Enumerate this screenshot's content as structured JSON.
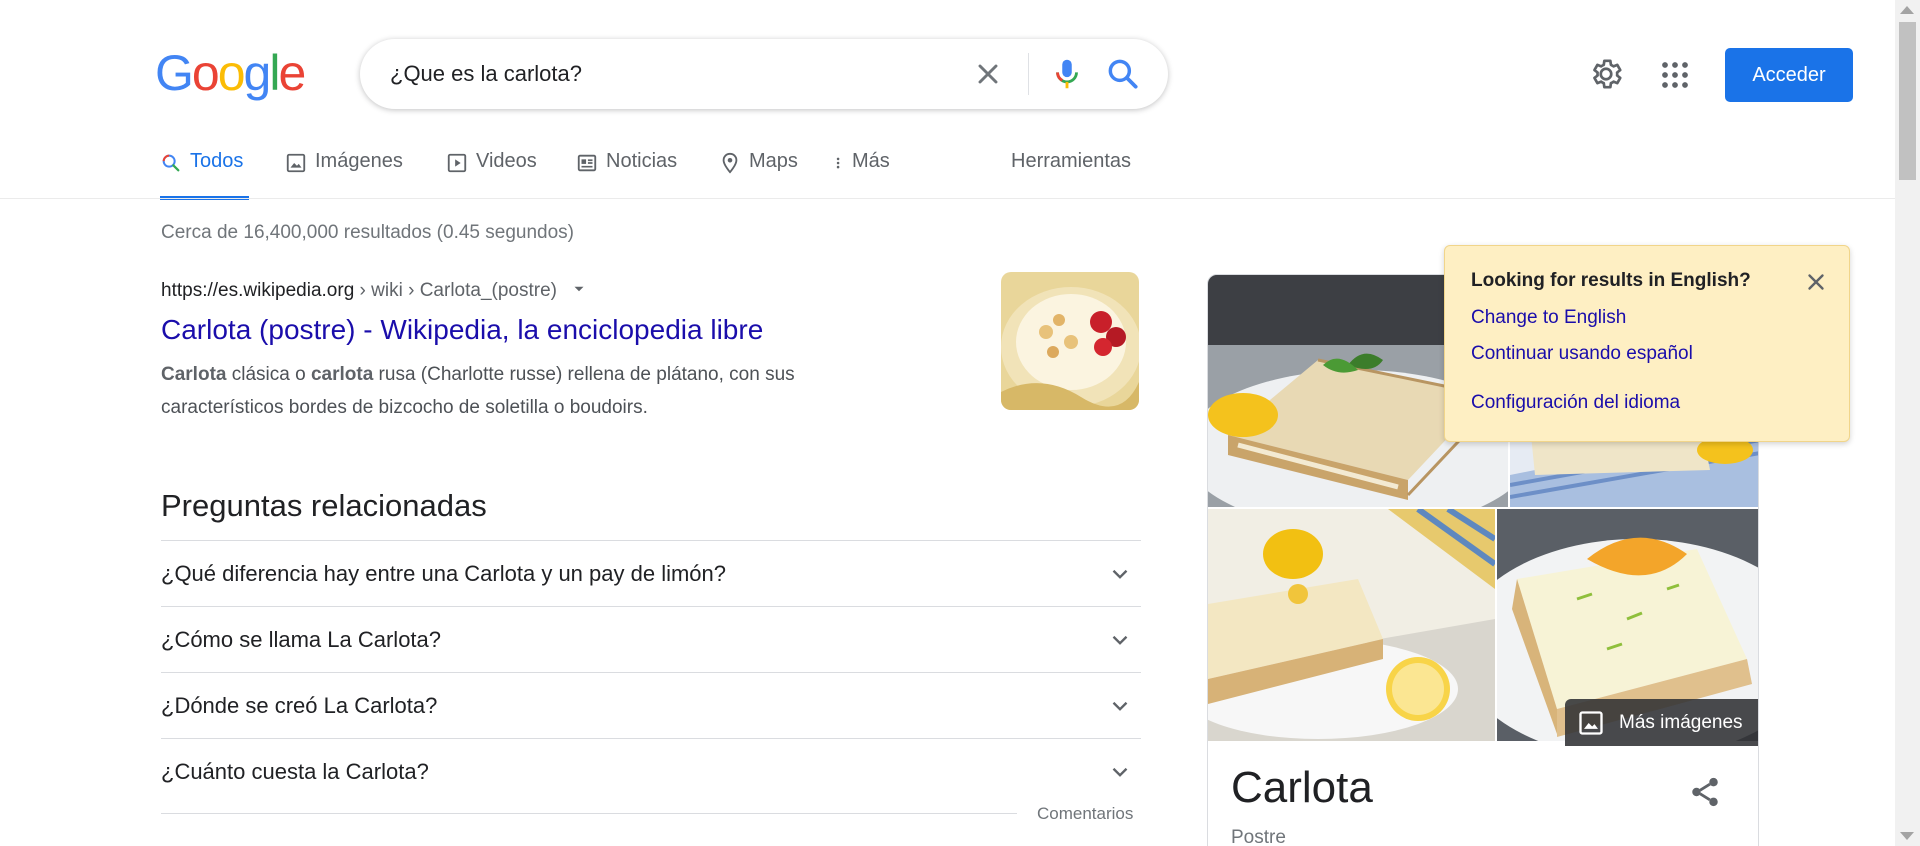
{
  "header": {
    "logo_letters": [
      {
        "ch": "G",
        "color": "#4285F4"
      },
      {
        "ch": "o",
        "color": "#EA4335"
      },
      {
        "ch": "o",
        "color": "#FBBC05"
      },
      {
        "ch": "g",
        "color": "#4285F4"
      },
      {
        "ch": "l",
        "color": "#34A853"
      },
      {
        "ch": "e",
        "color": "#EA4335"
      }
    ],
    "search_query": "¿Que es la carlota?",
    "clear_icon": "close-icon",
    "mic_icon": "microphone-icon",
    "search_icon": "search-icon",
    "settings_icon": "gear-icon",
    "apps_icon": "apps-grid-icon",
    "signin_label": "Acceder",
    "accent": "#1a73e8"
  },
  "tabs": [
    {
      "label": "Todos",
      "icon": "search-icon",
      "active": true
    },
    {
      "label": "Imágenes",
      "icon": "image-icon",
      "active": false
    },
    {
      "label": "Videos",
      "icon": "play-icon",
      "active": false
    },
    {
      "label": "Noticias",
      "icon": "news-icon",
      "active": false
    },
    {
      "label": "Maps",
      "icon": "map-pin-icon",
      "active": false
    },
    {
      "label": "Más",
      "icon": "more-vertical-icon",
      "active": false
    }
  ],
  "tools_label": "Herramientas",
  "result_stats": "Cerca de 16,400,000 resultados (0.45 segundos)",
  "result": {
    "url_domain": "https://es.wikipedia.org",
    "url_path": " › wiki › Carlota_(postre)",
    "title": "Carlota (postre) - Wikipedia, la enciclopedia libre",
    "snippet": [
      {
        "text": "Carlota",
        "bold": true
      },
      {
        "text": " clásica o ",
        "bold": false
      },
      {
        "text": "carlota",
        "bold": true
      },
      {
        "text": " rusa (Charlotte russe) rellena de plátano, con sus característicos bordes de bizcocho de soletilla o boudoirs.",
        "bold": false
      }
    ]
  },
  "related": {
    "title": "Preguntas relacionadas",
    "questions": [
      "¿Qué diferencia hay entre una Carlota y un pay de limón?",
      "¿Cómo se llama La Carlota?",
      "¿Dónde se creó La Carlota?",
      "¿Cuánto cuesta la Carlota?"
    ],
    "feedback": "Comentarios"
  },
  "knowledge_panel": {
    "more_images": "Más imágenes",
    "title": "Carlota",
    "subtitle": "Postre",
    "share_icon": "share-icon"
  },
  "lang_popup": {
    "heading": "Looking for results in English?",
    "change": "Change to English",
    "continue": "Continuar usando español",
    "settings": "Configuración del idioma",
    "close_icon": "close-icon"
  }
}
